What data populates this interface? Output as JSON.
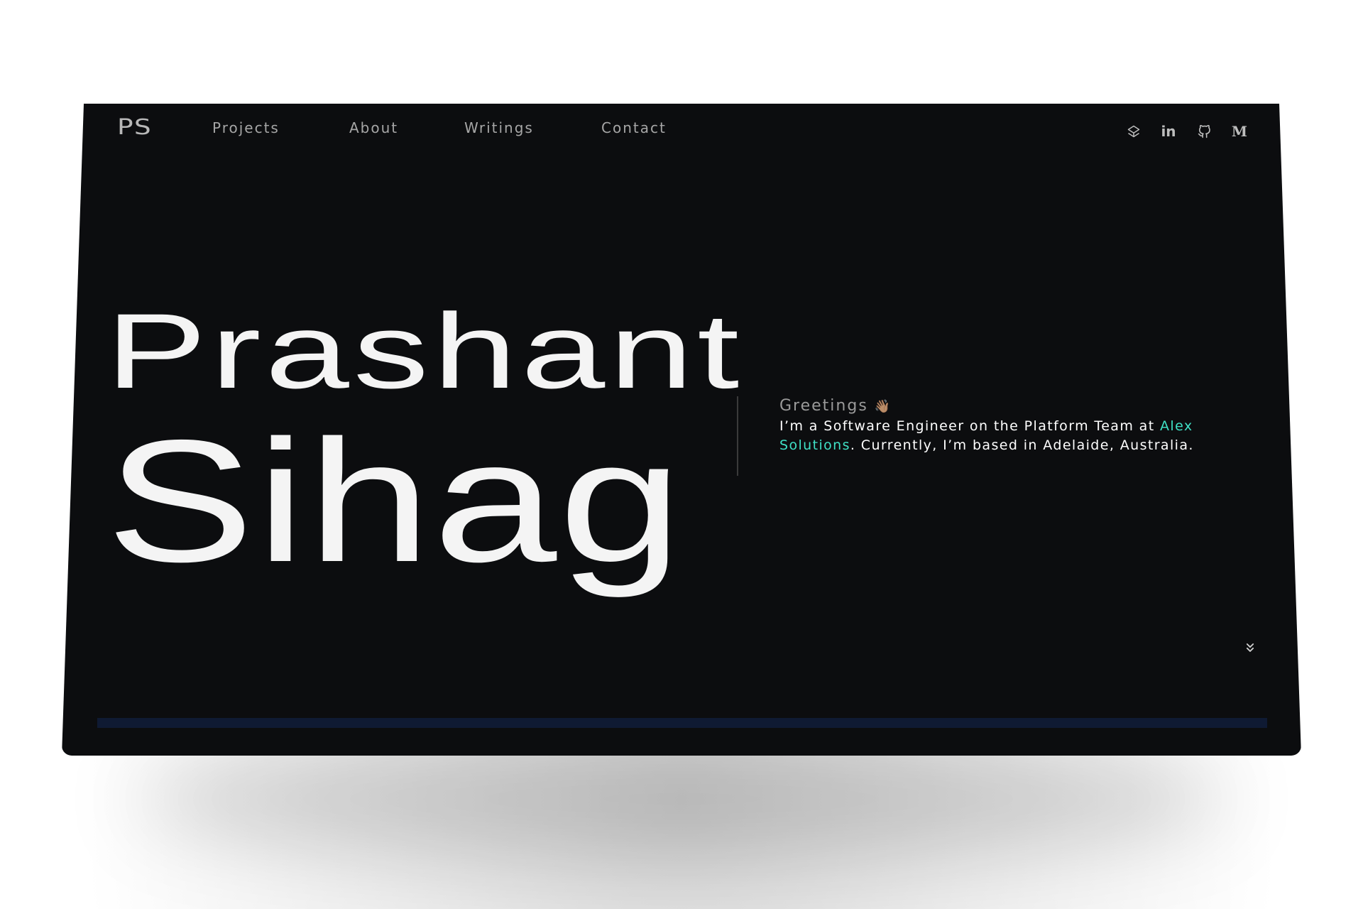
{
  "header": {
    "logo": "PS",
    "nav": [
      {
        "label": "Projects"
      },
      {
        "label": "About"
      },
      {
        "label": "Writings"
      },
      {
        "label": "Contact"
      }
    ],
    "social_icons": [
      "codepen-icon",
      "linkedin-icon",
      "github-icon",
      "medium-icon"
    ],
    "linkedin_label": "in",
    "medium_label": "M"
  },
  "hero": {
    "first_name": "Prashant",
    "last_name": "Sihag",
    "greeting": "Greetings",
    "greeting_emoji": "👋🏽",
    "intro_before": "I’m a Software Engineer on the Platform Team at ",
    "company": "Alex Solutions",
    "intro_after": ". Currently, I’m based in Adelaide, Australia.",
    "scroll_icon": "chevrons-down-icon"
  },
  "colors": {
    "background": "#0c0d0f",
    "accent": "#3fe0c5",
    "text": "#f4f4f4",
    "muted": "#a6a6a6",
    "progress_track": "#0f1a33"
  }
}
